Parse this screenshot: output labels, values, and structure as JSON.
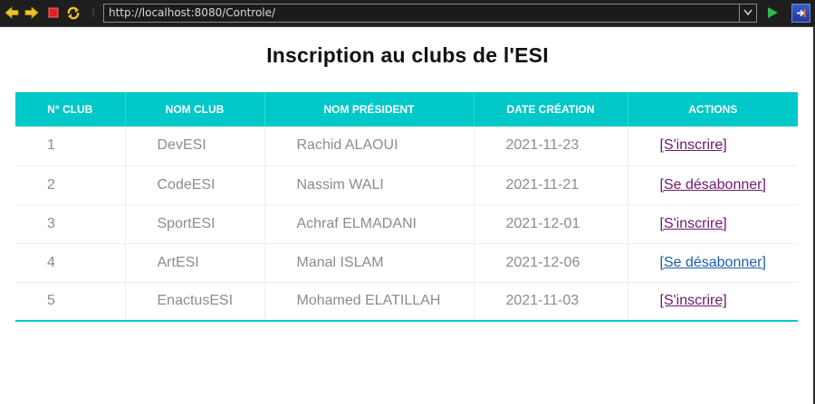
{
  "browser": {
    "url": "http://localhost:8080/Controle/"
  },
  "page": {
    "title": "Inscription au clubs de l'ESI"
  },
  "table": {
    "headers": [
      "N° CLUB",
      "NOM CLUB",
      "NOM PRÉSIDENT",
      "DATE CRÉATION",
      "ACTIONS"
    ],
    "rows": [
      {
        "num": "1",
        "nom_club": "DevESI",
        "president": "Rachid ALAOUI",
        "date": "2021-11-23",
        "action": "[S'inscrire]",
        "action_state": "visited"
      },
      {
        "num": "2",
        "nom_club": "CodeESI",
        "president": "Nassim WALI",
        "date": "2021-11-21",
        "action": "[Se désabonner]",
        "action_state": "visited"
      },
      {
        "num": "3",
        "nom_club": "SportESI",
        "president": "Achraf ELMADANI",
        "date": "2021-12-01",
        "action": "[S'inscrire]",
        "action_state": "visited"
      },
      {
        "num": "4",
        "nom_club": "ArtESI",
        "president": "Manal ISLAM",
        "date": "2021-12-06",
        "action": "[Se désabonner]",
        "action_state": "unvisited"
      },
      {
        "num": "5",
        "nom_club": "EnactusESI",
        "president": "Mohamed ELATILLAH",
        "date": "2021-11-03",
        "action": "[S'inscrire]",
        "action_state": "visited"
      }
    ]
  },
  "colors": {
    "header_bg": "#00c8c8",
    "visited_link": "#6b1a6b",
    "unvisited_link": "#1a5fa8",
    "cell_text": "#8c8c8c"
  },
  "icons": [
    "back-arrow-icon",
    "forward-arrow-icon",
    "stop-icon",
    "refresh-icon",
    "dropdown-chevron-icon",
    "go-play-icon",
    "extension-icon"
  ]
}
